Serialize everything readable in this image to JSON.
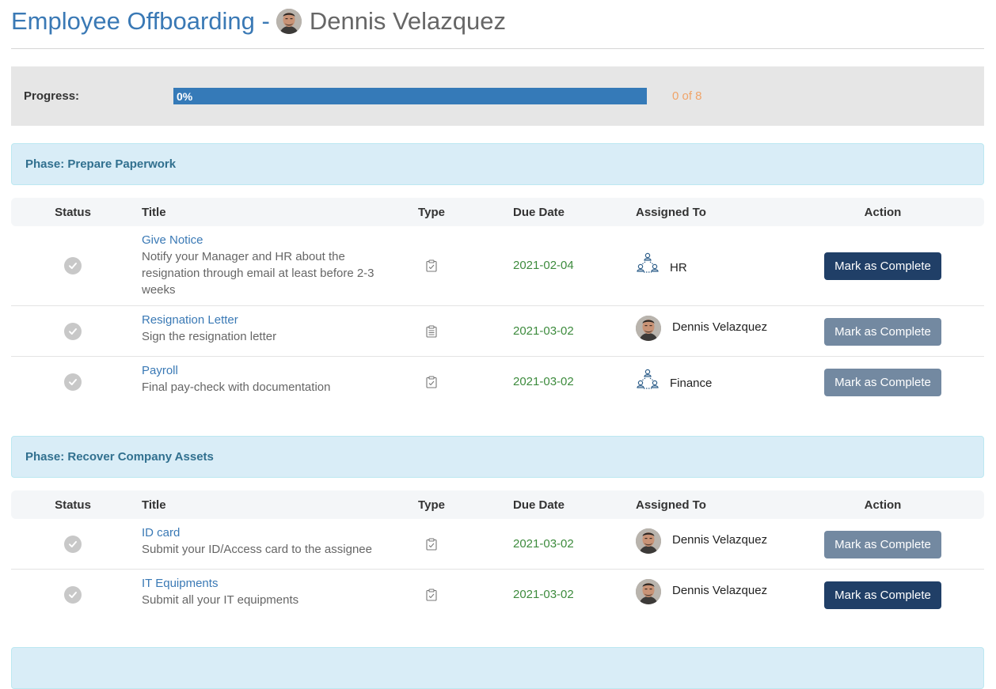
{
  "header": {
    "title_lead": "Employee Offboarding -",
    "employee_name": "Dennis Velazquez"
  },
  "progress": {
    "label": "Progress:",
    "percent_text": "0%",
    "fraction": 0.0,
    "count_text": "0 of 8"
  },
  "columns": {
    "status": "Status",
    "title": "Title",
    "type": "Type",
    "due_date": "Due Date",
    "assigned_to": "Assigned To",
    "action": "Action"
  },
  "phases": [
    {
      "label": "Phase: Prepare Paperwork",
      "tasks": [
        {
          "title": "Give Notice",
          "description": "Notify your Manager and HR about the resignation through email at least before 2-3 weeks",
          "type_icon": "clipboard-check-icon",
          "due": "2021-02-04",
          "assignee": "HR",
          "assignee_icon": "group-icon",
          "action": "Mark as Complete",
          "action_state": "primary"
        },
        {
          "title": "Resignation Letter",
          "description": "Sign the resignation letter",
          "type_icon": "clipboard-list-icon",
          "due": "2021-03-02",
          "assignee": "Dennis Velazquez",
          "assignee_icon": "avatar",
          "action": "Mark as Complete",
          "action_state": "disabled"
        },
        {
          "title": "Payroll",
          "description": "Final pay-check with documentation",
          "type_icon": "clipboard-check-icon",
          "due": "2021-03-02",
          "assignee": "Finance",
          "assignee_icon": "group-icon",
          "action": "Mark as Complete",
          "action_state": "disabled"
        }
      ]
    },
    {
      "label": "Phase: Recover Company Assets",
      "tasks": [
        {
          "title": "ID card",
          "description": "Submit your ID/Access card to the assignee",
          "type_icon": "clipboard-check-icon",
          "due": "2021-03-02",
          "assignee": "Dennis Velazquez",
          "assignee_icon": "avatar",
          "action": "Mark as Complete",
          "action_state": "disabled"
        },
        {
          "title": "IT Equipments",
          "description": "Submit all your IT equipments",
          "type_icon": "clipboard-check-icon",
          "due": "2021-03-02",
          "assignee": "Dennis Velazquez",
          "assignee_icon": "avatar",
          "action": "Mark as Complete",
          "action_state": "primary"
        }
      ]
    }
  ],
  "colors": {
    "accent": "#3a79b5",
    "primary_button": "#203f67",
    "disabled_button": "#7389a1",
    "due_date": "#3d8b3d",
    "progress_count": "#f0a469",
    "phase_background": "#d9edf7"
  }
}
